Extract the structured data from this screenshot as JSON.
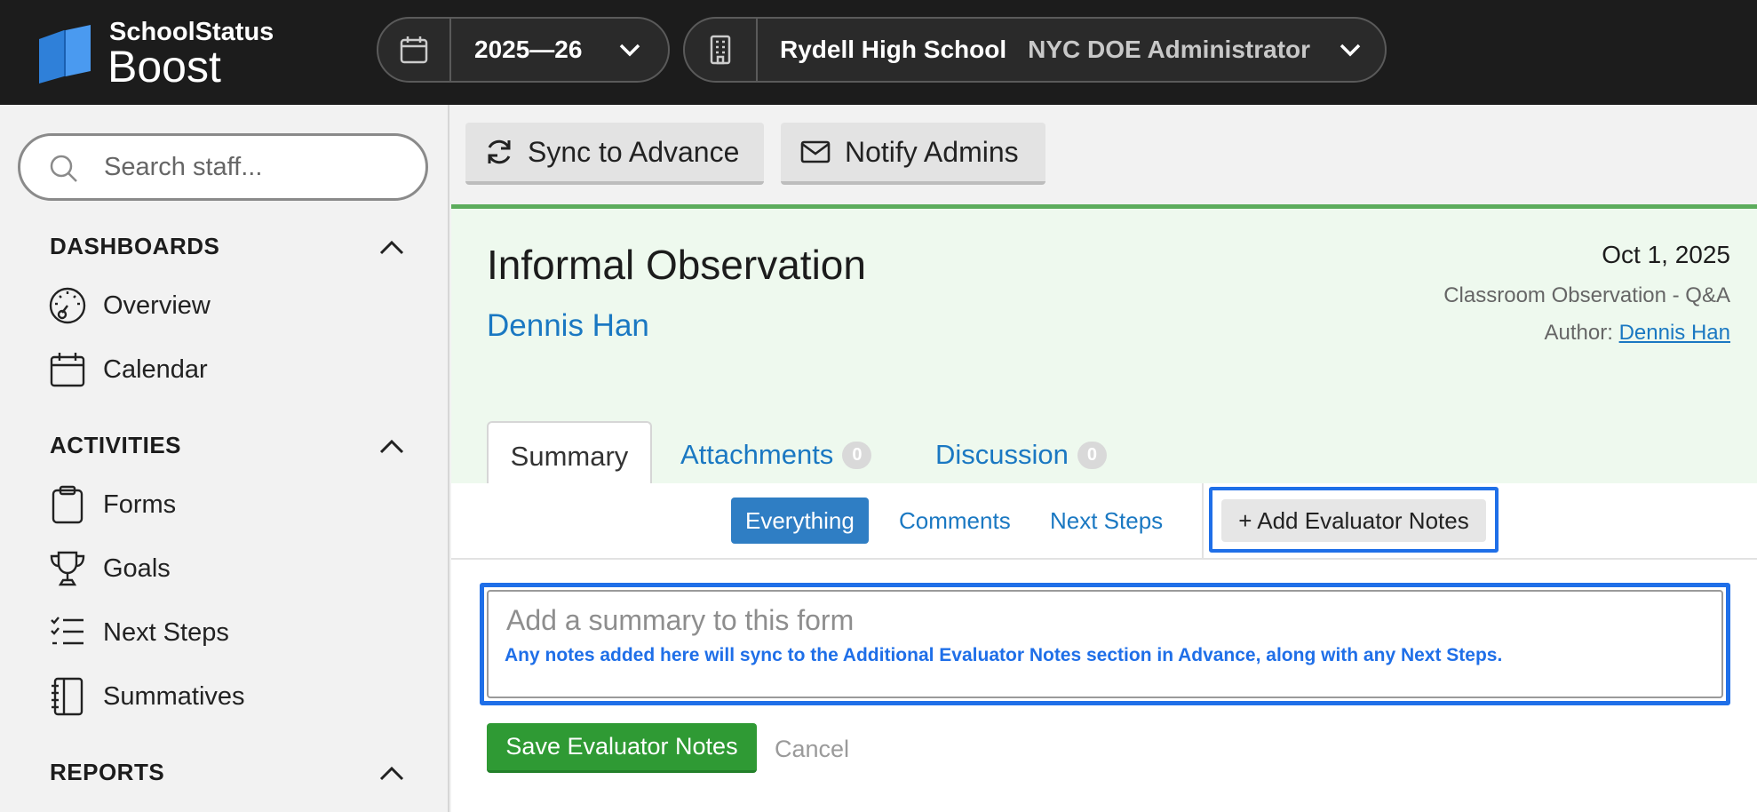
{
  "brand": {
    "top": "SchoolStatus",
    "main": "Boost"
  },
  "year_selector": {
    "label": "2025—26"
  },
  "school_selector": {
    "school": "Rydell High School",
    "role": "NYC DOE Administrator"
  },
  "search": {
    "placeholder": "Search staff..."
  },
  "sidebar": {
    "dashboards": {
      "title": "DASHBOARDS",
      "items": [
        {
          "label": "Overview",
          "icon": "speedometer-icon"
        },
        {
          "label": "Calendar",
          "icon": "calendar-icon"
        }
      ]
    },
    "activities": {
      "title": "ACTIVITIES",
      "items": [
        {
          "label": "Forms",
          "icon": "clipboard-icon"
        },
        {
          "label": "Goals",
          "icon": "trophy-icon"
        },
        {
          "label": "Next Steps",
          "icon": "checklist-icon"
        },
        {
          "label": "Summatives",
          "icon": "notebook-icon"
        }
      ]
    },
    "reports": {
      "title": "REPORTS"
    }
  },
  "toolbar": {
    "sync_label": "Sync to Advance",
    "notify_label": "Notify Admins"
  },
  "form": {
    "title": "Informal Observation",
    "staff": "Dennis Han",
    "date": "Oct 1, 2025",
    "type": "Classroom Observation - Q&A",
    "author_label": "Author:",
    "author": "Dennis Han"
  },
  "tabs": [
    {
      "label": "Summary"
    },
    {
      "label": "Attachments",
      "count": "0"
    },
    {
      "label": "Discussion",
      "count": "0"
    }
  ],
  "filters": [
    {
      "label": "Everything",
      "active": true
    },
    {
      "label": "Comments"
    },
    {
      "label": "Next Steps"
    }
  ],
  "add_notes_label": "+ Add Evaluator Notes",
  "summary": {
    "placeholder": "Add a summary to this form",
    "hint": "Any notes added here will sync to the Additional Evaluator Notes section in Advance, along with any Next Steps."
  },
  "actions": {
    "save_label": "Save Evaluator Notes",
    "cancel_label": "Cancel"
  },
  "colors": {
    "accent_blue": "#1a78c2",
    "highlight": "#1f6fe8",
    "save_green": "#2f9a34",
    "header_green_border": "#5cac5c"
  }
}
